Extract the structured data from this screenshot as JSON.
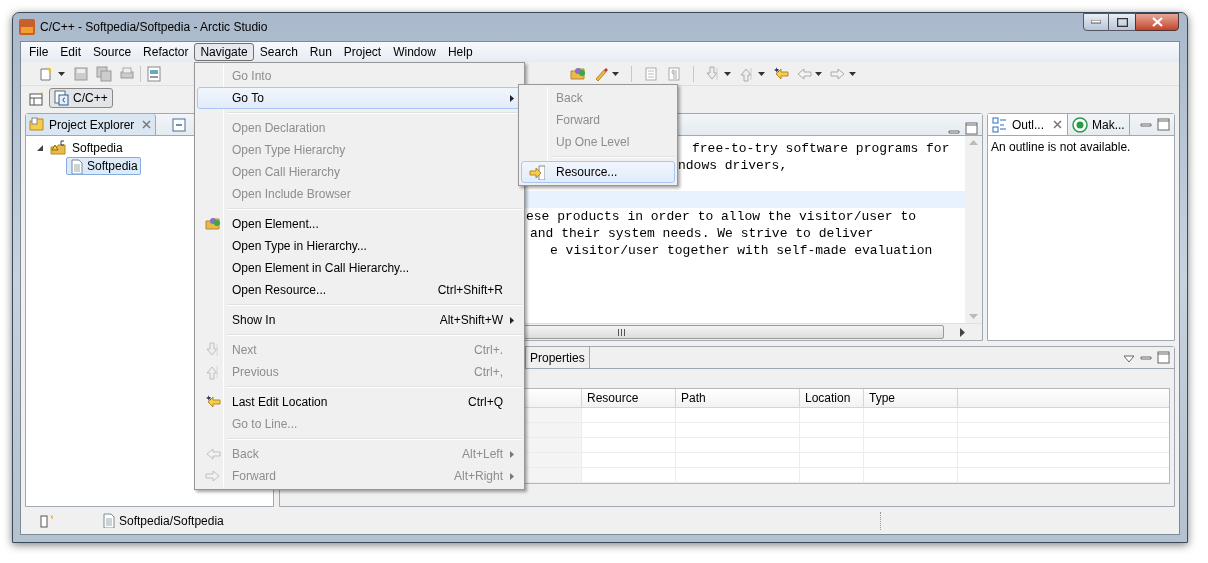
{
  "window": {
    "title": "C/C++ - Softpedia/Softpedia - Arctic Studio"
  },
  "menubar": [
    {
      "label": "File",
      "selected": false
    },
    {
      "label": "Edit",
      "selected": false
    },
    {
      "label": "Source",
      "selected": false
    },
    {
      "label": "Refactor",
      "selected": false
    },
    {
      "label": "Navigate",
      "selected": true
    },
    {
      "label": "Search",
      "selected": false
    },
    {
      "label": "Run",
      "selected": false
    },
    {
      "label": "Project",
      "selected": false
    },
    {
      "label": "Window",
      "selected": false
    },
    {
      "label": "Help",
      "selected": false
    }
  ],
  "perspective": {
    "label": "C/C++",
    "selected": true
  },
  "project_explorer": {
    "title": "Project Explorer",
    "tree": [
      {
        "label": "Softpedia",
        "expanded": true,
        "selected": false,
        "children": [
          {
            "label": "Softpedia",
            "selected": true
          }
        ]
      }
    ]
  },
  "editor": {
    "lines": [
      {
        "text": "free-to-try software programs for",
        "current": false
      },
      {
        "text": "ndows drivers,",
        "current": false
      },
      {
        "current": true
      },
      {
        "text": "ese products in order to allow the visitor/user to",
        "current": false
      },
      {
        "text": "and their system needs. We strive to deliver",
        "current": false
      },
      {
        "text": "e visitor/user together with self-made evaluation",
        "current": false
      }
    ]
  },
  "outline": {
    "tabs": [
      {
        "label": "Outl...",
        "selected": true
      },
      {
        "label": "Mak...",
        "selected": false
      }
    ],
    "message": "An outline is not available."
  },
  "bottom_panel": {
    "tabs": [
      {
        "label": "Properties",
        "selected": false
      }
    ],
    "columns": [
      "Resource",
      "Path",
      "Location",
      "Type"
    ]
  },
  "status_bar": {
    "path": "Softpedia/Softpedia"
  },
  "navigate_menu": [
    {
      "kind": "item",
      "label": "Go Into",
      "disabled": true,
      "selected": false
    },
    {
      "kind": "item",
      "label": "Go To",
      "disabled": false,
      "selected": true,
      "submenu": true
    },
    {
      "kind": "separator"
    },
    {
      "kind": "item",
      "label": "Open Declaration",
      "disabled": true,
      "selected": false
    },
    {
      "kind": "item",
      "label": "Open Type Hierarchy",
      "disabled": true,
      "selected": false
    },
    {
      "kind": "item",
      "label": "Open Call Hierarchy",
      "disabled": true,
      "selected": false
    },
    {
      "kind": "item",
      "label": "Open Include Browser",
      "disabled": true,
      "selected": false
    },
    {
      "kind": "separator"
    },
    {
      "kind": "item",
      "label": "Open Element...",
      "disabled": false,
      "selected": false
    },
    {
      "kind": "item",
      "label": "Open Type in Hierarchy...",
      "disabled": false,
      "selected": false
    },
    {
      "kind": "item",
      "label": "Open Element in Call Hierarchy...",
      "disabled": false,
      "selected": false
    },
    {
      "kind": "item",
      "label": "Open Resource...",
      "shortcut": "Ctrl+Shift+R",
      "disabled": false,
      "selected": false
    },
    {
      "kind": "separator"
    },
    {
      "kind": "item",
      "label": "Show In",
      "shortcut": "Alt+Shift+W",
      "disabled": false,
      "selected": false,
      "submenu": true
    },
    {
      "kind": "separator"
    },
    {
      "kind": "item",
      "label": "Next",
      "shortcut": "Ctrl+.",
      "disabled": true,
      "selected": false
    },
    {
      "kind": "item",
      "label": "Previous",
      "shortcut": "Ctrl+,",
      "disabled": true,
      "selected": false
    },
    {
      "kind": "separator"
    },
    {
      "kind": "item",
      "label": "Last Edit Location",
      "shortcut": "Ctrl+Q",
      "disabled": false,
      "selected": false
    },
    {
      "kind": "item",
      "label": "Go to Line...",
      "disabled": true,
      "selected": false
    },
    {
      "kind": "separator"
    },
    {
      "kind": "item",
      "label": "Back",
      "shortcut": "Alt+Left",
      "disabled": true,
      "selected": false,
      "submenu": true
    },
    {
      "kind": "item",
      "label": "Forward",
      "shortcut": "Alt+Right",
      "disabled": true,
      "selected": false,
      "submenu": true
    }
  ],
  "goto_submenu": [
    {
      "kind": "item",
      "label": "Back",
      "disabled": true,
      "selected": false
    },
    {
      "kind": "item",
      "label": "Forward",
      "disabled": true,
      "selected": false
    },
    {
      "kind": "item",
      "label": "Up One Level",
      "disabled": true,
      "selected": false
    },
    {
      "kind": "separator"
    },
    {
      "kind": "item",
      "label": "Resource...",
      "disabled": false,
      "selected": true
    }
  ]
}
